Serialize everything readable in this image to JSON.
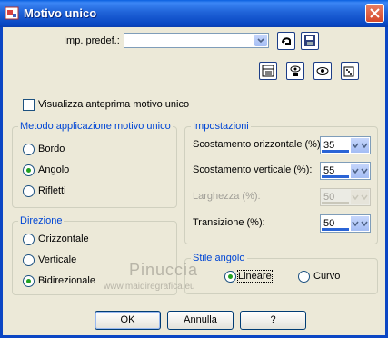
{
  "window": {
    "title": "Motivo unico"
  },
  "preset": {
    "label": "Imp. predef.:",
    "value": ""
  },
  "preview_checkbox": {
    "label": "Visualizza anteprima motivo unico",
    "checked": false
  },
  "method_group": {
    "title": "Metodo applicazione motivo unico",
    "options": [
      {
        "label": "Bordo",
        "selected": false
      },
      {
        "label": "Angolo",
        "selected": true
      },
      {
        "label": "Rifletti",
        "selected": false
      }
    ]
  },
  "direction_group": {
    "title": "Direzione",
    "options": [
      {
        "label": "Orizzontale",
        "selected": false
      },
      {
        "label": "Verticale",
        "selected": false
      },
      {
        "label": "Bidirezionale",
        "selected": true
      }
    ]
  },
  "settings_group": {
    "title": "Impostazioni",
    "fields": [
      {
        "label": "Scostamento orizzontale (%):",
        "value": "35",
        "enabled": true
      },
      {
        "label": "Scostamento verticale (%):",
        "value": "55",
        "enabled": true
      },
      {
        "label": "Larghezza (%):",
        "value": "50",
        "enabled": false
      },
      {
        "label": "Transizione (%):",
        "value": "50",
        "enabled": true
      }
    ]
  },
  "corner_group": {
    "title": "Stile angolo",
    "options": [
      {
        "label": "Lineare",
        "selected": true
      },
      {
        "label": "Curvo",
        "selected": false
      }
    ]
  },
  "watermark": {
    "line1": "Pinuccia",
    "line2": "www.maidiregrafica.eu"
  },
  "buttons": {
    "ok": "OK",
    "cancel": "Annulla",
    "help": "?"
  },
  "colors": {
    "title_bar": "#0a5fe0",
    "group_title": "#0046d5",
    "dialog_bg": "#ece9d8"
  }
}
